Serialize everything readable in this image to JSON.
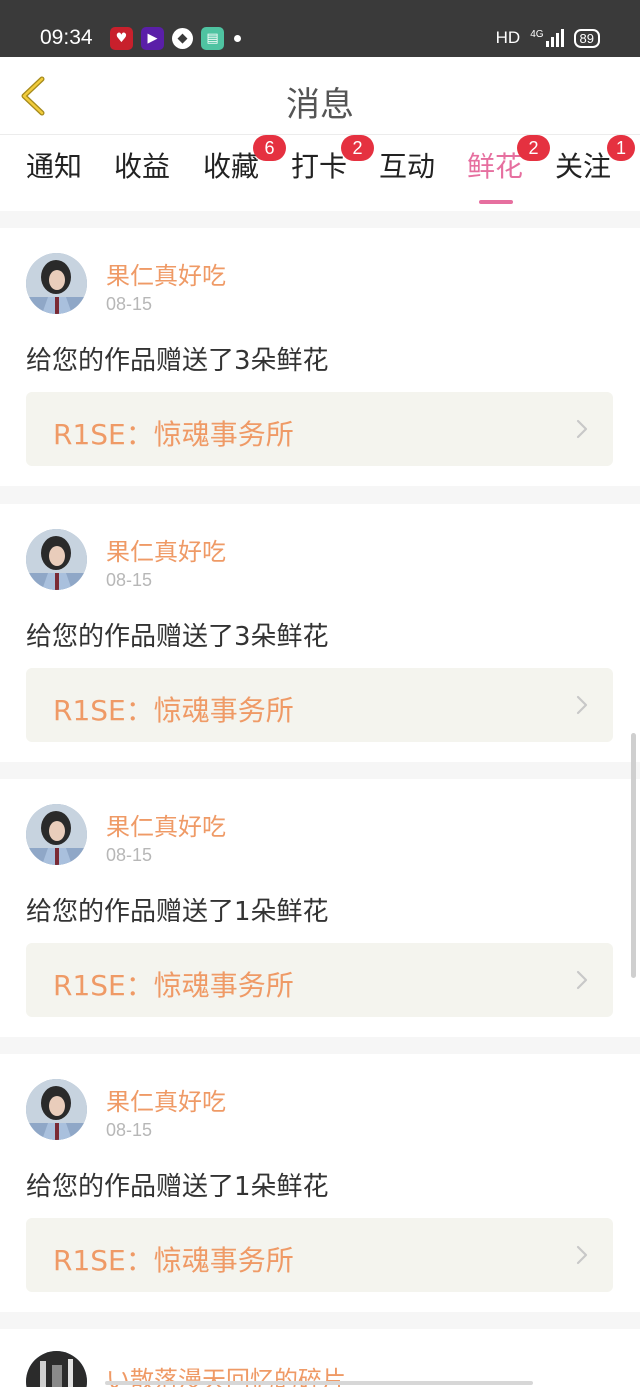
{
  "status_bar": {
    "time": "09:34",
    "network": "HD",
    "signal": "4G",
    "battery": "89",
    "app_icons": [
      "heart-app-icon",
      "video-app-icon",
      "bird-app-icon",
      "chat-app-icon"
    ]
  },
  "header": {
    "title": "消息",
    "back_icon": "chevron-left-icon"
  },
  "tabs": [
    {
      "label": "通知",
      "badge": ""
    },
    {
      "label": "收益",
      "badge": ""
    },
    {
      "label": "收藏",
      "badge": "6"
    },
    {
      "label": "打卡",
      "badge": "2"
    },
    {
      "label": "互动",
      "badge": ""
    },
    {
      "label": "鲜花",
      "badge": "2",
      "active": true
    },
    {
      "label": "关注",
      "badge": "1"
    }
  ],
  "colors": {
    "accent": "#e66f9f",
    "username": "#ef9a66",
    "badge": "#e53140"
  },
  "messages": [
    {
      "username": "果仁真好吃",
      "date": "08-15",
      "text": "给您的作品赠送了3朵鲜花",
      "work": "R1SE：惊魂事务所"
    },
    {
      "username": "果仁真好吃",
      "date": "08-15",
      "text": "给您的作品赠送了3朵鲜花",
      "work": "R1SE：惊魂事务所"
    },
    {
      "username": "果仁真好吃",
      "date": "08-15",
      "text": "给您的作品赠送了1朵鲜花",
      "work": "R1SE：惊魂事务所"
    },
    {
      "username": "果仁真好吃",
      "date": "08-15",
      "text": "给您的作品赠送了1朵鲜花",
      "work": "R1SE：惊魂事务所"
    }
  ],
  "partial_message": {
    "username": "い散落漫天回忆的碎片"
  }
}
